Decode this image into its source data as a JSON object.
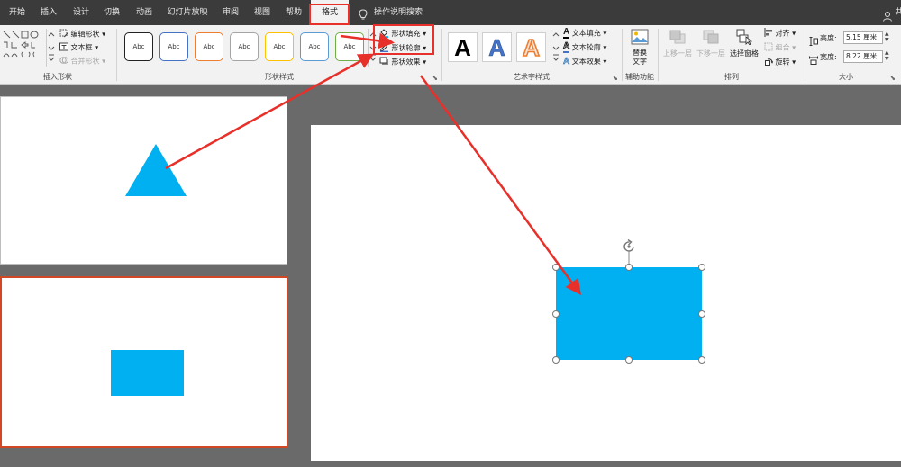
{
  "tabs": [
    {
      "id": "home",
      "label": "开始"
    },
    {
      "id": "insert",
      "label": "插入"
    },
    {
      "id": "design",
      "label": "设计"
    },
    {
      "id": "transitions",
      "label": "切换"
    },
    {
      "id": "animations",
      "label": "动画"
    },
    {
      "id": "slideshow",
      "label": "幻灯片放映"
    },
    {
      "id": "review",
      "label": "审阅"
    },
    {
      "id": "view",
      "label": "视图"
    },
    {
      "id": "help",
      "label": "帮助"
    },
    {
      "id": "format",
      "label": "格式",
      "active": true
    }
  ],
  "search": {
    "label": "操作说明搜索",
    "icon": "lightbulb-icon"
  },
  "account": {
    "label": "共",
    "icon": "person-icon"
  },
  "ribbon": {
    "insert_shapes": {
      "label": "插入形状",
      "edit_shape": "编辑形状",
      "text_box": "文本框",
      "merge_shapes": "合并形状",
      "merge_disabled": true
    },
    "shape_styles": {
      "label": "形状样式",
      "swatches": [
        {
          "text": "Abc",
          "border": "#222222"
        },
        {
          "text": "Abc",
          "border": "#4472c4"
        },
        {
          "text": "Abc",
          "border": "#ed7d31"
        },
        {
          "text": "Abc",
          "border": "#a5a5a5"
        },
        {
          "text": "Abc",
          "border": "#ffc000"
        },
        {
          "text": "Abc",
          "border": "#5b9bd5"
        },
        {
          "text": "Abc",
          "border": "#70ad47"
        }
      ],
      "fill": "形状填充",
      "outline": "形状轮廓",
      "effects": "形状效果"
    },
    "wordart": {
      "label": "艺术字样式",
      "samples": [
        {
          "text": "A",
          "color": "#000000"
        },
        {
          "text": "A",
          "color": "#4472c4"
        },
        {
          "text": "A",
          "color": "#ed7d31"
        }
      ],
      "text_fill": "文本填充",
      "text_outline": "文本轮廓",
      "text_effects": "文本效果"
    },
    "accessibility": {
      "label": "辅助功能",
      "alt_text_l1": "替换",
      "alt_text_l2": "文字"
    },
    "arrange": {
      "label": "排列",
      "bring_forward": "上移一层",
      "send_backward": "下移一层",
      "selection_pane": "选择窗格",
      "align": "对齐",
      "group": "组合",
      "rotate": "旋转"
    },
    "size": {
      "label": "大小",
      "height_label": "高度:",
      "height_value": "5.15 厘米",
      "width_label": "宽度:",
      "width_value": "8.22 厘米"
    }
  },
  "colors": {
    "shape_blue": "#00b0f0",
    "annotation_red": "#e8302a",
    "selected_border": "#d24726"
  }
}
